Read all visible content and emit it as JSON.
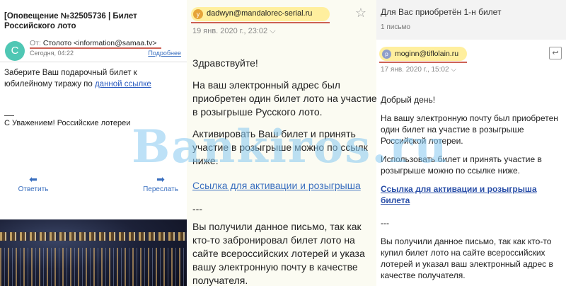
{
  "panel1": {
    "subject": "[Оповещение №32505736 | Билет Российского лото",
    "avatar_letter": "С",
    "from_label": "От:",
    "from_value": "Столото <information@samaa.tv>",
    "date": "Сегодня, 04:22",
    "more_link": "Подробнее",
    "body_text": "Заберите Ваш подарочный билет к юбилейному тиражу по",
    "body_link": "данной ссылке",
    "signature": "С Уважением! Российские лотереи",
    "reply_label": "Ответить",
    "forward_label": "Переслать",
    "reply_icon": "reply-icon",
    "forward_icon": "forward-icon"
  },
  "panel2": {
    "avatar_letter": "y",
    "sender": "dadwyn@mandalorec-serial.ru",
    "date": "19 янв. 2020 г., 23:02",
    "star_icon": "star-icon",
    "greeting": "Здравствуйте!",
    "para1": "На ваш электронный адрес  был приобретен один  билет лото на участие в розыгрыше Русского лото.",
    "para2": "Активировать Ваш билет и принять участие в розыгрыше можно по ссылк ниже.",
    "link": "Ссылка для активации и розыгрыша",
    "sep": "---",
    "para3": "Вы получили данное письмо, так как кто-то забронировал билет лото на сайте всероссийских лотерей и указа вашу электронную почту в качестве получателя."
  },
  "panel3": {
    "subject": "Для Вас приобретён 1-н билет",
    "count": "1 письмо",
    "avatar_letter": "p",
    "sender": "moginn@tiflolain.ru",
    "date": "17 янв. 2020 г., 15:02",
    "reply_icon": "reply-icon",
    "greeting": "Добрый день!",
    "para1": "На вашу электронную почту  был приобретен один  билет на участие в розыгрыше Российской лотереи.",
    "para2": "Использовать билет и принять участие в розыгрыше можно по ссылке ниже.",
    "link": "Ссылка для активации и розыгрыша билета",
    "sep": "---",
    "para3": "Вы получили данное письмо, так как кто-то купил билет лото на сайте всероссийских лотерей и указал  ваш электронный адрес в качестве получателя."
  },
  "watermark": "Bankiros.ru",
  "colors": {
    "sender_highlight": "#ffef9e",
    "underline_red": "#c0392b",
    "link_blue": "#3a6fbf",
    "avatar_teal": "#4fc7b4",
    "watermark": "#87c8f0"
  }
}
